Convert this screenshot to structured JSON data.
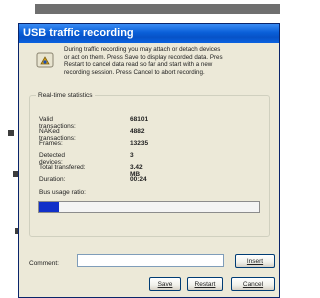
{
  "window": {
    "title": "USB traffic recording"
  },
  "info": {
    "text": "During traffic recording you may attach or detach devices\nor act on them. Press Save to display recorded data. Pres\nRestart to cancel data read so far and start with a new\nrecording session. Press Cancel to abort recording."
  },
  "stats": {
    "legend": "Real-time statistics",
    "rows": [
      {
        "label": "Valid transactions:",
        "value": "68101"
      },
      {
        "label": "NAKed transactions:",
        "value": "4882"
      },
      {
        "label": "Frames:",
        "value": "13235"
      },
      {
        "label": "Detected devices:",
        "value": "3"
      },
      {
        "label": "Total transfered:",
        "value": "3.42 MB"
      },
      {
        "label": "Duration:",
        "value": "00:24"
      }
    ],
    "bus_label": "Bus usage ratio:",
    "bus_usage": 0.09
  },
  "comment": {
    "label": "Comment:",
    "value": ""
  },
  "buttons": {
    "insert": "Insert",
    "save": "Save",
    "restart": "Restart",
    "cancel": "Cancel"
  },
  "colors": {
    "titlebar": "#0a5fd8",
    "progress": "#1130c9",
    "dialog_bg": "#ece9d8"
  }
}
